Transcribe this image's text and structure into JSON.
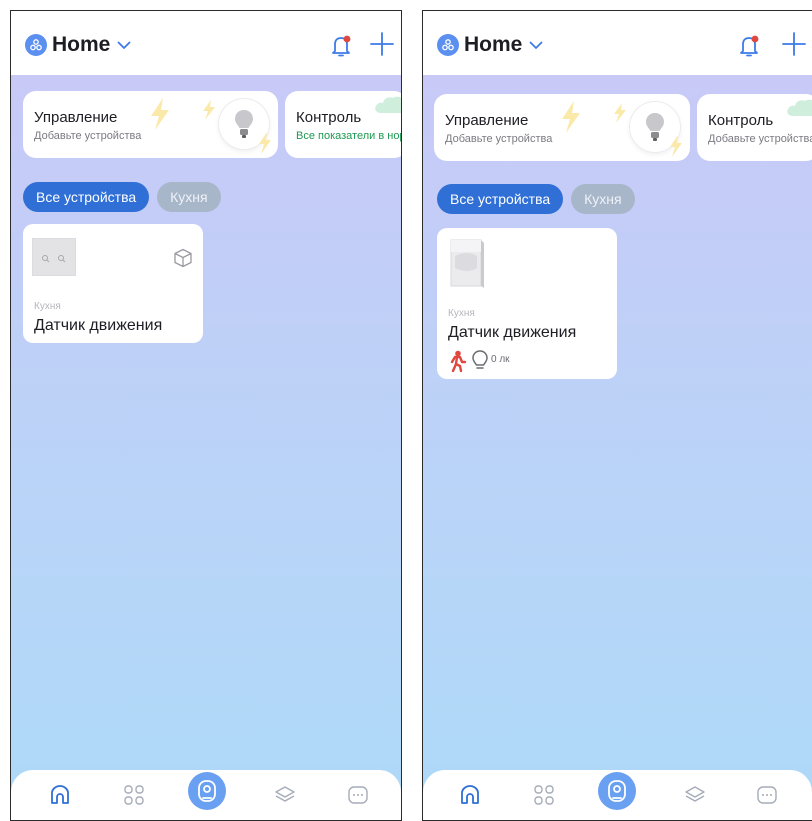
{
  "screens": [
    {
      "header": {
        "home_label": "Home"
      },
      "cards": [
        {
          "title": "Управление",
          "subtitle": "Добавьте устройства"
        },
        {
          "title": "Контроль",
          "subtitle": "Все показатели в норме"
        }
      ],
      "chips": [
        {
          "label": "Все устройства"
        },
        {
          "label": "Кухня"
        }
      ],
      "device": {
        "room": "Кухня",
        "name": "Датчик движения"
      }
    },
    {
      "header": {
        "home_label": "Home"
      },
      "cards": [
        {
          "title": "Управление",
          "subtitle": "Добавьте устройства"
        },
        {
          "title": "Контроль",
          "subtitle": "Добавьте устройства"
        }
      ],
      "chips": [
        {
          "label": "Все устройства"
        },
        {
          "label": "Кухня"
        }
      ],
      "device": {
        "room": "Кухня",
        "name": "Датчик движения",
        "illuminance": "0 лк"
      }
    }
  ],
  "colors": {
    "accent": "#2f6fd6",
    "chip_inactive": "#a8b6c9",
    "tab_active": "#6aa0f2",
    "status_ok": "#1d9a52",
    "motion_alert": "#e0483f"
  },
  "icons": {
    "header": [
      "home-logo-icon",
      "chevron-down-icon",
      "bell-icon",
      "plus-icon"
    ],
    "tabs": [
      "home-icon",
      "grid-icon",
      "smart-center-icon",
      "layers-icon",
      "more-icon"
    ]
  }
}
